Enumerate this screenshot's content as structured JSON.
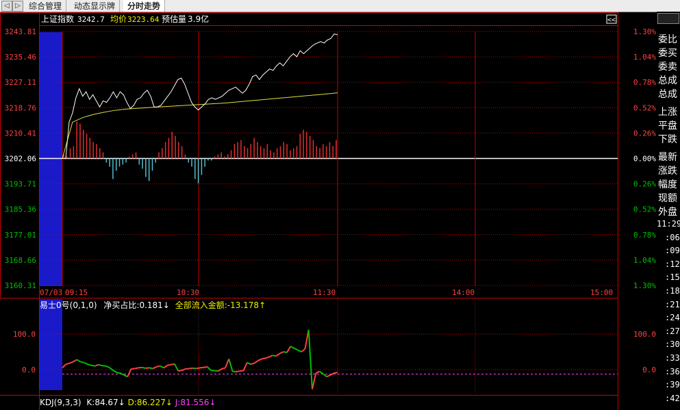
{
  "tabs": [
    {
      "label": "综合管理",
      "active": false
    },
    {
      "label": "动态显示牌",
      "active": false
    },
    {
      "label": "分时走势",
      "active": true
    }
  ],
  "nav_icons": [
    "prev-tab-arrow",
    "next-tab-arrow"
  ],
  "header": {
    "index_label": "上证指数",
    "index_value": "3242.7",
    "avg_label": "均价",
    "avg_value": "3223.64",
    "est_label": "预估量",
    "est_value": "3.9亿",
    "collapse_glyph": "<<"
  },
  "main_chart": {
    "y_left_labels": [
      "3243.81",
      "3235.46",
      "3227.11",
      "3218.76",
      "3210.41",
      "3202.06",
      "3193.71",
      "3185.36",
      "3177.01",
      "3168.66",
      "3160.31"
    ],
    "y_right_labels": [
      "1.30%",
      "1.04%",
      "0.78%",
      "0.52%",
      "0.26%",
      "0.00%",
      "0.26%",
      "0.52%",
      "0.78%",
      "1.04%",
      "1.30%"
    ],
    "x_labels": [
      "07/03",
      "09:15",
      "10:30",
      "11:30",
      "14:00",
      "15:00"
    ]
  },
  "indicator_panel": {
    "name": "易士0号",
    "params": "(0,1,0)",
    "net_buy_label": "净买占比",
    "net_buy_value": "0.181",
    "net_buy_arrow": "↓",
    "inflow_label": "全部流入金额",
    "inflow_value": "-13.178",
    "inflow_arrow": "↑",
    "y_labels": [
      "100.0",
      "0.0"
    ]
  },
  "kdj_panel": {
    "name": "KDJ",
    "params": "(9,3,3)",
    "k_label": "K",
    "k_value": "84.67",
    "k_arrow": "↓",
    "d_label": "D",
    "d_value": "86.227",
    "d_arrow": "↓",
    "j_label": "J",
    "j_value": "81.556",
    "j_arrow": "↓"
  },
  "side_panel": {
    "labels": [
      "委比",
      "委买",
      "委卖",
      "总成",
      "总成",
      "上涨",
      "平盘",
      "下跌",
      "最新",
      "涨跌",
      "幅度",
      "现额",
      "外盘"
    ],
    "times": [
      "11:29",
      ":06",
      ":09",
      ":12",
      ":15",
      ":18",
      ":21",
      ":24",
      ":27",
      ":30",
      ":33",
      ":36",
      ":39",
      ":42"
    ]
  },
  "colors": {
    "grid_red": "#cc0000",
    "up_red": "#ff4040",
    "down_green": "#00c000",
    "price_line": "#ffffff",
    "avg_line": "#e0e040",
    "volume_up": "#e03030",
    "volume_down": "#50c0d0",
    "auction_blue": "#1a1ac8",
    "header_yellow": "#f0f000",
    "kdj_d": "#f0f000",
    "kdj_j": "#ff40ff"
  },
  "chart_data": {
    "type": "line",
    "title": "上证指数",
    "base_price": 3202.06,
    "ylim": [
      3160.31,
      3243.81
    ],
    "x_session": [
      "09:15",
      "10:30",
      "11:30",
      "14:00",
      "15:00"
    ],
    "price_series": {
      "name": "上证指数",
      "values": [
        3202.06,
        3202.06,
        3214.0,
        3217.0,
        3222.0,
        3225.0,
        3222.5,
        3224.0,
        3221.5,
        3223.0,
        3221.0,
        3219.0,
        3221.0,
        3220.5,
        3222.0,
        3224.0,
        3222.0,
        3224.0,
        3223.0,
        3220.5,
        3218.5,
        3219.5,
        3221.5,
        3222.0,
        3223.5,
        3224.5,
        3222.5,
        3219.0,
        3219.0,
        3219.5,
        3221.0,
        3222.5,
        3224.0,
        3226.0,
        3228.0,
        3228.5,
        3226.5,
        3223.5,
        3220.5,
        3219.0,
        3218.0,
        3219.0,
        3220.0,
        3221.5,
        3222.0,
        3221.5,
        3222.0,
        3222.5,
        3223.5,
        3224.5,
        3225.0,
        3225.5,
        3224.5,
        3223.5,
        3224.5,
        3226.5,
        3229.0,
        3229.5,
        3228.0,
        3229.5,
        3230.5,
        3231.5,
        3231.0,
        3232.5,
        3233.5,
        3232.5,
        3234.0,
        3235.5,
        3236.5,
        3235.5,
        3237.5,
        3236.5,
        3237.5,
        3238.5,
        3239.5,
        3240.0,
        3240.5,
        3240.0,
        3241.0,
        3241.5,
        3243.0,
        3242.7
      ]
    },
    "avg_series": {
      "name": "均价",
      "values": [
        3202.06,
        3214.0,
        3215.5,
        3216.5,
        3217.2,
        3217.8,
        3218.2,
        3218.5,
        3218.7,
        3218.9,
        3219.1,
        3219.3,
        3219.5,
        3219.7,
        3219.9,
        3220.1,
        3220.3,
        3220.6,
        3220.9,
        3221.2,
        3221.5,
        3221.8,
        3222.1,
        3222.4,
        3222.7,
        3223.0,
        3223.3,
        3223.64
      ]
    },
    "volume_bars": [
      0.1,
      0.05,
      0.25,
      0.3,
      0.9,
      0.85,
      0.7,
      0.6,
      0.5,
      0.4,
      0.35,
      0.25,
      0.15,
      -0.1,
      -0.2,
      -0.5,
      -0.3,
      -0.2,
      -0.15,
      -0.1,
      0.05,
      0.1,
      0.15,
      -0.15,
      -0.25,
      -0.45,
      -0.55,
      -0.3,
      -0.1,
      0.15,
      0.25,
      0.4,
      0.5,
      0.65,
      0.55,
      0.4,
      0.3,
      0.1,
      -0.1,
      -0.2,
      -0.5,
      -0.6,
      -0.4,
      -0.2,
      -0.05,
      -0.05,
      0.05,
      0.1,
      0.15,
      0.05,
      0.1,
      0.2,
      0.35,
      0.4,
      0.45,
      0.3,
      0.25,
      0.35,
      0.5,
      0.4,
      0.3,
      0.25,
      0.35,
      0.2,
      0.15,
      0.25,
      0.3,
      0.4,
      0.35,
      0.2,
      0.25,
      0.3,
      0.6,
      0.7,
      0.65,
      0.55,
      0.45,
      0.3,
      0.25,
      0.35,
      0.3,
      0.4,
      0.3,
      0.45
    ],
    "indicator_series": {
      "name": "易士0号",
      "values": [
        5,
        15,
        18,
        22,
        28,
        22,
        20,
        15,
        12,
        10,
        14,
        11,
        10,
        6,
        -2,
        -8,
        -10,
        -15,
        -20,
        2,
        3,
        5,
        6,
        4,
        5,
        3,
        8,
        10,
        5,
        12,
        14,
        16,
        -4,
        -2,
        2,
        3,
        4,
        3,
        5,
        6,
        8,
        -2,
        -3,
        -4,
        2,
        5,
        30,
        -5,
        -6,
        -4,
        -3,
        20,
        15,
        18,
        25,
        30,
        32,
        35,
        40,
        38,
        45,
        50,
        48,
        65,
        60,
        55,
        50,
        58,
        112,
        -55,
        -10,
        -5,
        -12,
        -20,
        -15,
        -10,
        -8
      ]
    }
  }
}
